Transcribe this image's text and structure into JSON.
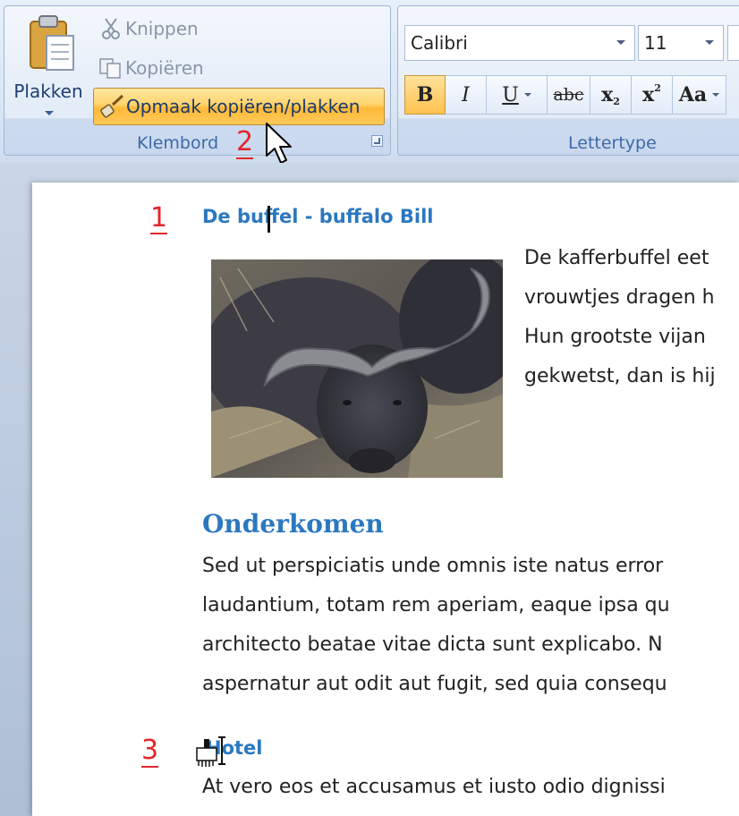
{
  "ribbon": {
    "clipboard": {
      "paste_label": "Plakken",
      "cut_label": "Knippen",
      "copy_label": "Kopiëren",
      "format_painter_label": "Opmaak kopiëren/plakken",
      "group_label": "Klembord"
    },
    "font": {
      "font_name": "Calibri",
      "font_size": "11",
      "bold": "B",
      "italic": "I",
      "underline": "U",
      "strikethrough": "abc",
      "subscript": "x",
      "subscript_small": "2",
      "superscript": "x",
      "superscript_small": "2",
      "change_case": "Aa",
      "group_label": "Lettertype"
    }
  },
  "annotations": {
    "n1": "1",
    "n2": "2",
    "n3": "3"
  },
  "document": {
    "heading1": "De buffel - buffalo Bill",
    "side_lines": [
      "De kafferbuffel eet",
      "vrouwtjes dragen h",
      "Hun grootste vijan",
      "gekwetst, dan is hij"
    ],
    "heading2": "Onderkomen",
    "para_lines": [
      "Sed ut perspiciatis unde omnis iste natus error",
      "laudantium, totam rem aperiam, eaque ipsa qu",
      "architecto beatae vitae dicta sunt explicabo. N",
      "aspernatur aut odit aut fugit, sed quia consequ"
    ],
    "heading3": "Hotel",
    "last_line": "At vero eos et accusamus et iusto odio dignissi"
  },
  "colors": {
    "heading": "#2b78c0",
    "annotation": "#e2262b",
    "active_button": "#ffc24f"
  }
}
